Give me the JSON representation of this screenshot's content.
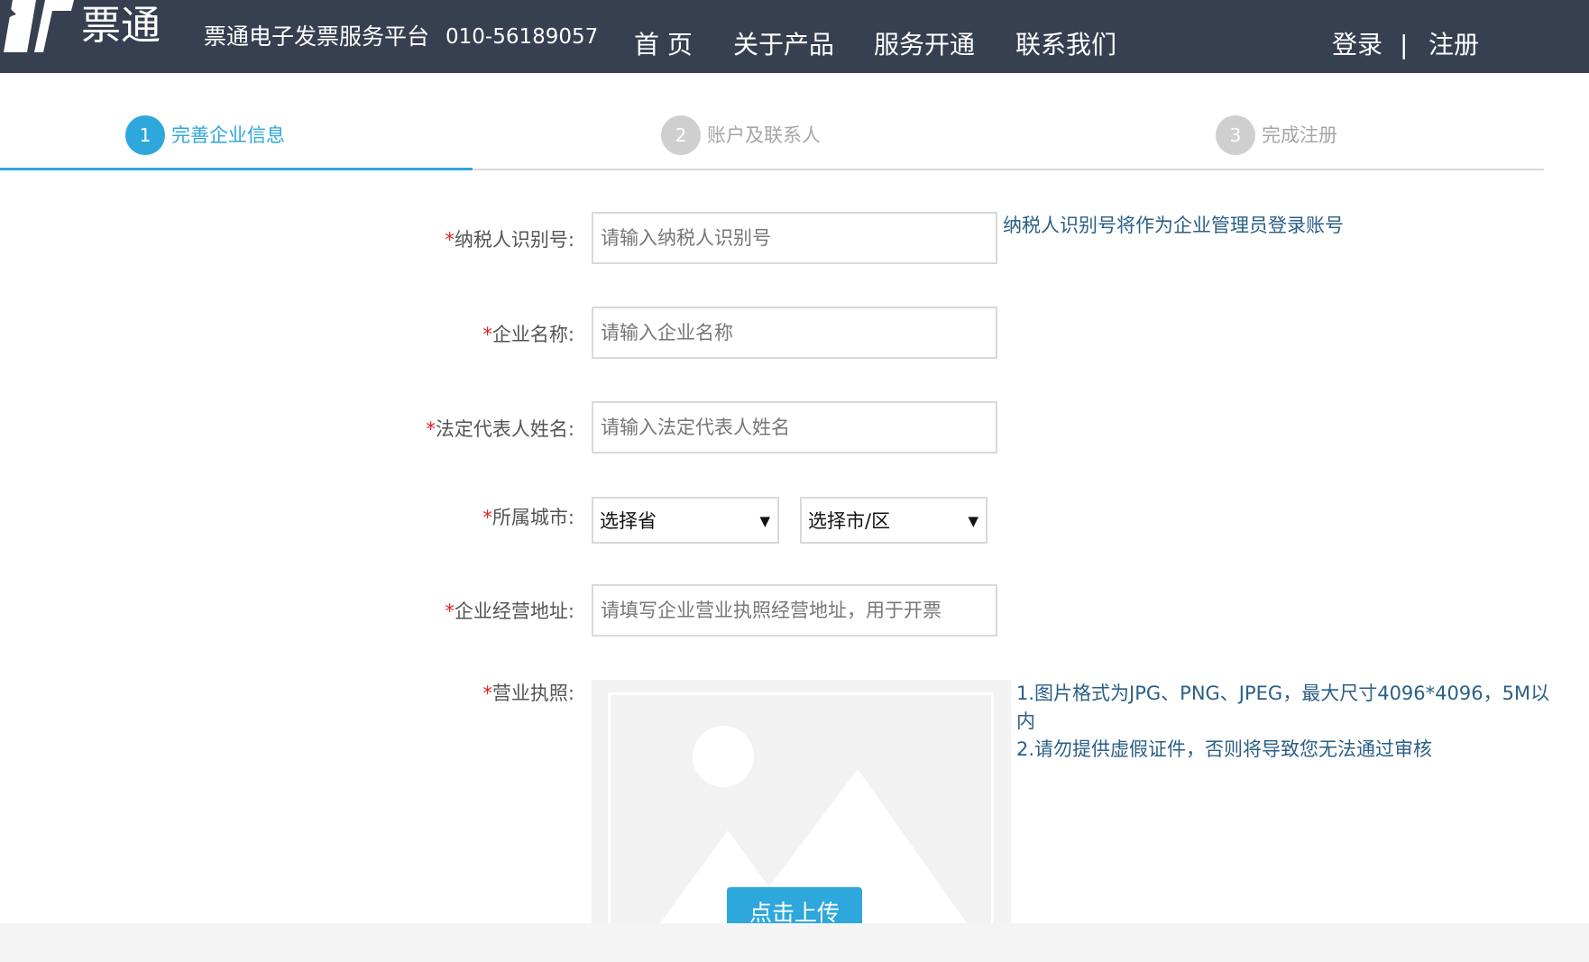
{
  "header": {
    "logo_text": "票通",
    "site_name": "票通电子发票服务平台",
    "phone": "010-56189057",
    "nav": {
      "home": "首 页",
      "product": "关于产品",
      "service": "服务开通",
      "contact": "联系我们"
    },
    "login": "登录",
    "separator": "|",
    "register": "注册"
  },
  "steps": [
    {
      "number": "1",
      "label": "完善企业信息"
    },
    {
      "number": "2",
      "label": "账户及联系人"
    },
    {
      "number": "3",
      "label": "完成注册"
    }
  ],
  "form": {
    "required_mark": "*",
    "taxpayer": {
      "label": "纳税人识别号:",
      "placeholder": "请输入纳税人识别号",
      "hint": "纳税人识别号将作为企业管理员登录账号"
    },
    "company_name": {
      "label": "企业名称:",
      "placeholder": "请输入企业名称"
    },
    "legal_rep": {
      "label": "法定代表人姓名:",
      "placeholder": "请输入法定代表人姓名"
    },
    "city": {
      "label": "所属城市:",
      "province_value": "选择省",
      "city_value": "选择市/区"
    },
    "address": {
      "label": "企业经营地址:",
      "placeholder": "请填写企业营业执照经营地址，用于开票"
    },
    "license": {
      "label": "营业执照:",
      "hint_line1": "1.图片格式为JPG、PNG、JPEG，最大尺寸4096*4096，5M以内",
      "hint_line2": "2.请勿提供虚假证件，否则将导致您无法通过审核",
      "upload_label": "点击上传"
    }
  },
  "colors": {
    "header_bg": "#374050",
    "accent": "#2ea7dc",
    "required": "#e02020",
    "hint": "#2b5f86"
  }
}
